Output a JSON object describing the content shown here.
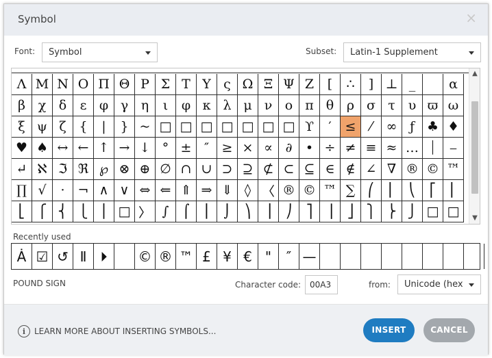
{
  "dialog": {
    "title": "Symbol",
    "close_glyph": "×"
  },
  "font": {
    "label": "Font:",
    "value": "Symbol"
  },
  "subset": {
    "label": "Subset:",
    "value": "Latin-1 Supplement"
  },
  "symbols": [
    [
      "Λ",
      "Μ",
      "Ν",
      "Ο",
      "Π",
      "Θ",
      "Ρ",
      "Σ",
      "Τ",
      "Υ",
      "ς",
      "Ω",
      "Ξ",
      "Ψ",
      "Ζ",
      "[",
      "∴",
      "]",
      "⊥",
      "_",
      "",
      "α"
    ],
    [
      "β",
      "χ",
      "δ",
      "ε",
      "φ",
      "γ",
      "η",
      "ι",
      "φ",
      "κ",
      "λ",
      "μ",
      "ν",
      "ο",
      "π",
      "θ",
      "ρ",
      "σ",
      "τ",
      "υ",
      "ϖ",
      "ω"
    ],
    [
      "ξ",
      "ψ",
      "ζ",
      "{",
      "|",
      "}",
      "~",
      "□",
      "□",
      "□",
      "□",
      "□",
      "□",
      "□",
      "ϒ",
      "′",
      "≤",
      "⁄",
      "∞",
      "ƒ",
      "♣",
      "♦"
    ],
    [
      "♥",
      "♠",
      "↔",
      "←",
      "↑",
      "→",
      "↓",
      "°",
      "±",
      "″",
      "≥",
      "×",
      "∝",
      "∂",
      "•",
      "÷",
      "≠",
      "≡",
      "≈",
      "…",
      "⏐",
      "⎯"
    ],
    [
      "↵",
      "ℵ",
      "ℑ",
      "ℜ",
      "℘",
      "⊗",
      "⊕",
      "∅",
      "∩",
      "∪",
      "⊃",
      "⊇",
      "⊄",
      "⊂",
      "⊆",
      "∈",
      "∉",
      "∠",
      "∇",
      "®",
      "©",
      "™"
    ],
    [
      "∏",
      "√",
      "·",
      "¬",
      "∧",
      "∨",
      "⇔",
      "⇐",
      "⇑",
      "⇒",
      "⇓",
      "◊",
      "〈",
      "®",
      "©",
      "™",
      "∑",
      "⎛",
      "⎜",
      "⎝",
      "⎡",
      "⎢"
    ],
    [
      "⎣",
      "⎧",
      "⎨",
      "⎩",
      "⎪",
      "□",
      "〉",
      "∫",
      "⌠",
      "⎮",
      "⌡",
      "⎞",
      "⎟",
      "⎠",
      "⎤",
      "⎥",
      "⎦",
      "⎫",
      "⎬",
      "⎭",
      "□",
      "□"
    ]
  ],
  "selected_symbol": "≤",
  "recently_used": {
    "label": "Recently used",
    "items": [
      "Ȧ",
      "☑",
      "↺",
      "Ⅱ",
      "⏵",
      "",
      "©",
      "®",
      "™",
      "£",
      "¥",
      "€",
      "\"",
      "″",
      "—",
      "",
      "",
      "",
      "",
      "",
      "",
      "",
      ""
    ]
  },
  "character_name": "POUND SIGN",
  "character_code": {
    "label": "Character code:",
    "value": "00A3"
  },
  "from": {
    "label": "from:",
    "value": "Unicode (hex"
  },
  "footer": {
    "learn_more": "LEARN MORE ABOUT INSERTING SYMBOLS...",
    "info_glyph": "i",
    "insert_label": "INSERT",
    "cancel_label": "CANCEL"
  },
  "scroll": {
    "up_glyph": "▲",
    "down_glyph": "▼"
  },
  "colors": {
    "accent": "#1f7cc1",
    "selected_cell": "#f0a36b",
    "cancel": "#a3a8ad",
    "title_bar": "#eaedf2"
  }
}
